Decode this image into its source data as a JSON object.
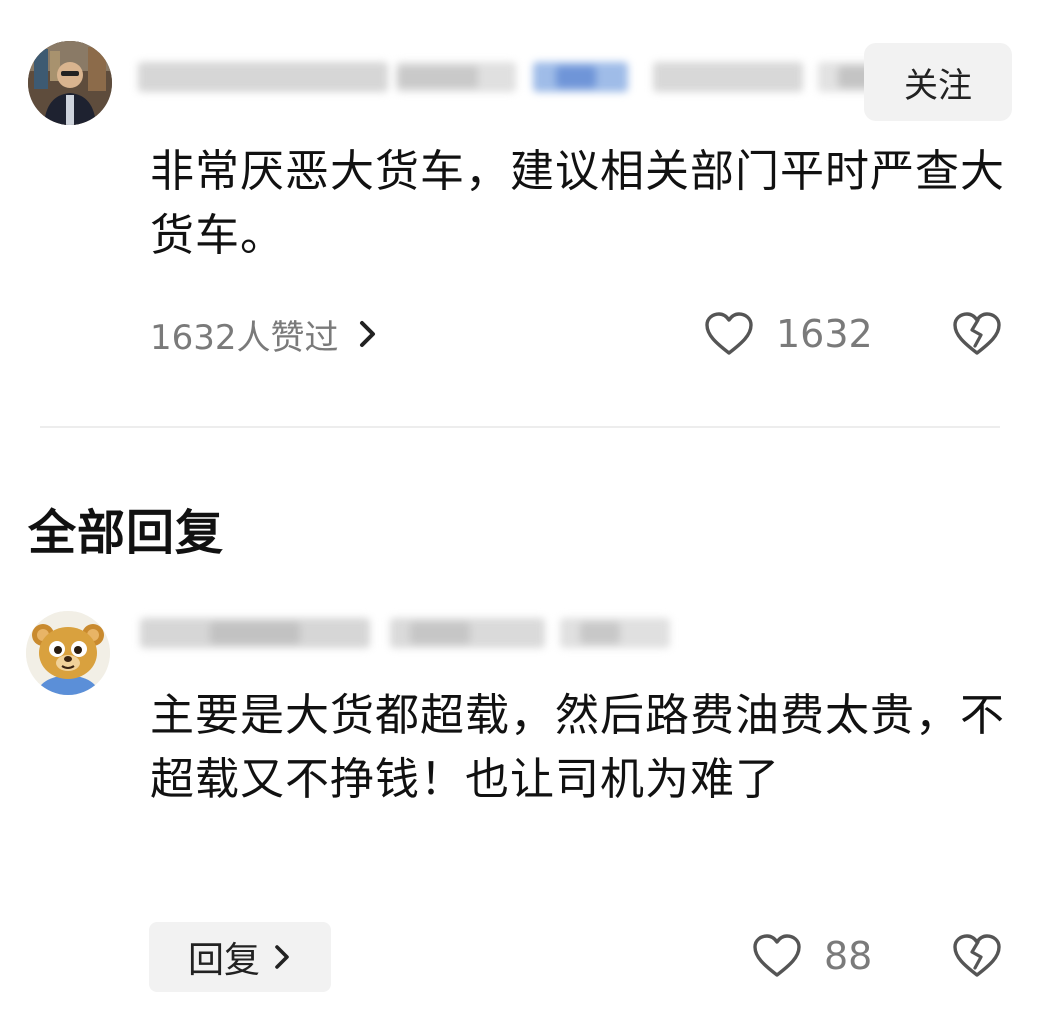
{
  "comment": {
    "follow_label": "关注",
    "text": "非常厌恶大货车，建议相关部门平时严查大货车。",
    "liked_by_label": "1632人赞过",
    "like_count": "1632"
  },
  "replies_section": {
    "title": "全部回复"
  },
  "replies": [
    {
      "text": "主要是大货都超载，然后路费油费太贵，不超载又不挣钱！也让司机为难了",
      "reply_label": "回复",
      "like_count": "88"
    }
  ],
  "icons": {
    "like": "heart-outline-icon",
    "dislike": "broken-heart-icon",
    "chevron": "chevron-right-icon"
  },
  "colors": {
    "text_primary": "#111111",
    "text_secondary": "#7a7a7a",
    "button_bg": "#f2f2f2",
    "divider": "#ededed"
  }
}
